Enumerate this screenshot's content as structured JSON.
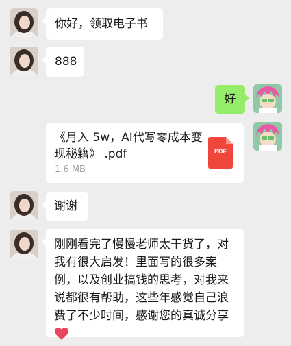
{
  "chat": {
    "messages": [
      {
        "side": "left",
        "type": "text",
        "text": "你好，领取电子书"
      },
      {
        "side": "left",
        "type": "text",
        "text": "888"
      },
      {
        "side": "right",
        "type": "text",
        "text": "好"
      },
      {
        "side": "right",
        "type": "file",
        "file_name": "《月入 5w，AI代写零成本变现秘籍》 .pdf",
        "file_size": "1.6 MB",
        "file_type": "PDF"
      },
      {
        "side": "left",
        "type": "text",
        "text": "谢谢"
      },
      {
        "side": "left",
        "type": "text",
        "text": "刚刚看完了慢慢老师太干货了，对我有很大启发！里面写的很多案例，以及创业搞钱的思考，对我来说都很有帮助，这些年感觉自己浪费了不少时间，感谢您的真诚分享",
        "emoji": "heart-icon"
      }
    ]
  },
  "colors": {
    "background": "#ededed",
    "bubble_left": "#ffffff",
    "bubble_right": "#95ec69",
    "pdf_red": "#f0463c",
    "heart": "#e8455e"
  }
}
